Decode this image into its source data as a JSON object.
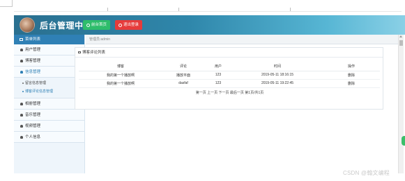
{
  "header": {
    "title": "后台管理中心",
    "home_button": "前台首页",
    "logout_button": "退出登录",
    "colors": {
      "home": "#2ebd6b",
      "logout": "#e63b3b",
      "header": "#2f87ab"
    }
  },
  "sidebar": {
    "title": "菜单列表",
    "items": [
      {
        "label": "用户管理",
        "icon": "user-icon"
      },
      {
        "label": "博客管理",
        "icon": "user-icon"
      },
      {
        "label": "信息管理",
        "icon": "user-icon",
        "active": true,
        "children": [
          {
            "label": "留言信息管理"
          },
          {
            "label": "博客评论信息管理",
            "current": true
          }
        ]
      },
      {
        "label": "相册管理",
        "icon": "user-icon"
      },
      {
        "label": "音乐管理",
        "icon": "user-icon"
      },
      {
        "label": "视频管理",
        "icon": "user-icon"
      },
      {
        "label": "个人信息",
        "icon": "user-icon"
      }
    ]
  },
  "breadcrumb": "管理员:admin",
  "panel": {
    "title": "博客评论列表",
    "columns": [
      "博客",
      "评论",
      "用户",
      "时间",
      "操作"
    ],
    "rows": [
      [
        "我的第一个播放啊",
        "播放平面",
        "123",
        "2019-05-11 18:16:15",
        "删除"
      ],
      [
        "我的第一个播放啊",
        "dasfaf",
        "123",
        "2019-05-11 19:22:45",
        "删除"
      ]
    ],
    "pager": "第一页 上一页 下一页 最后一页 第1页/共1页"
  },
  "watermark": "CSDN @翰文编程"
}
